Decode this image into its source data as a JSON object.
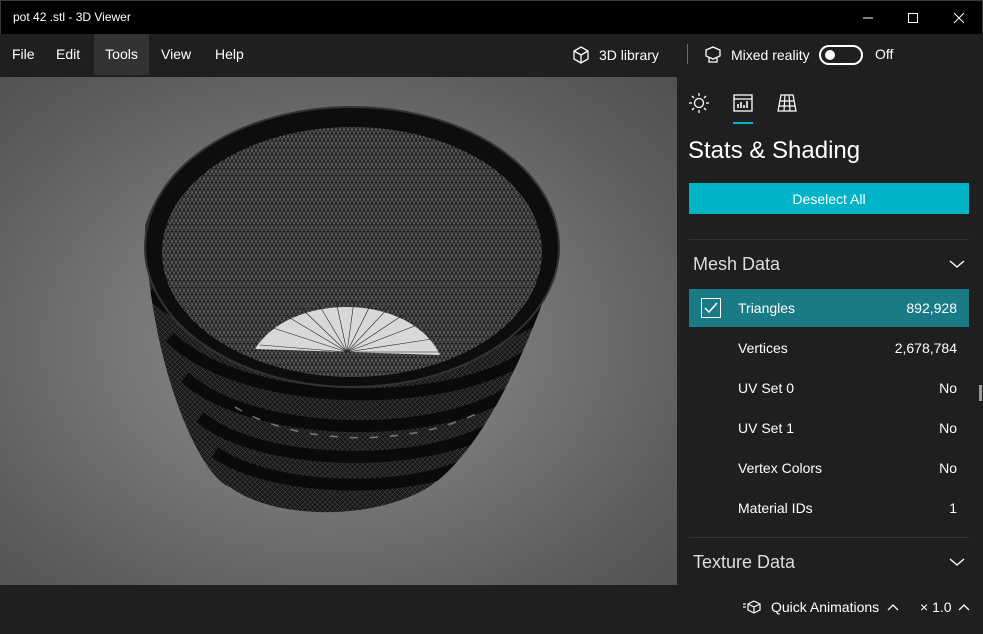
{
  "window": {
    "title": "pot 42 .stl - 3D Viewer"
  },
  "menu": {
    "items": [
      {
        "label": "File"
      },
      {
        "label": "Edit"
      },
      {
        "label": "Tools"
      },
      {
        "label": "View"
      },
      {
        "label": "Help"
      }
    ],
    "active": "Tools",
    "library_label": "3D library",
    "mixed_reality_label": "Mixed reality",
    "mixed_reality_state": "Off"
  },
  "panel": {
    "tabs": [
      {
        "name": "lighting",
        "icon": "sun-icon"
      },
      {
        "name": "stats",
        "icon": "stats-chart-icon"
      },
      {
        "name": "grid",
        "icon": "grid-icon"
      }
    ],
    "active_tab": "stats",
    "title": "Stats & Shading",
    "deselect_label": "Deselect All",
    "mesh_section": "Mesh Data",
    "rows": [
      {
        "label": "Triangles",
        "value": "892,928",
        "checked": true
      },
      {
        "label": "Vertices",
        "value": "2,678,784"
      },
      {
        "label": "UV Set 0",
        "value": "No"
      },
      {
        "label": "UV Set 1",
        "value": "No"
      },
      {
        "label": "Vertex Colors",
        "value": "No"
      },
      {
        "label": "Material IDs",
        "value": "1"
      }
    ],
    "texture_section": "Texture Data"
  },
  "status": {
    "animations_label": "Quick Animations",
    "speed": "× 1.0"
  },
  "colors": {
    "accent": "#00b4c8",
    "selected_row": "#1a7a85",
    "background": "#1f1f1f"
  }
}
